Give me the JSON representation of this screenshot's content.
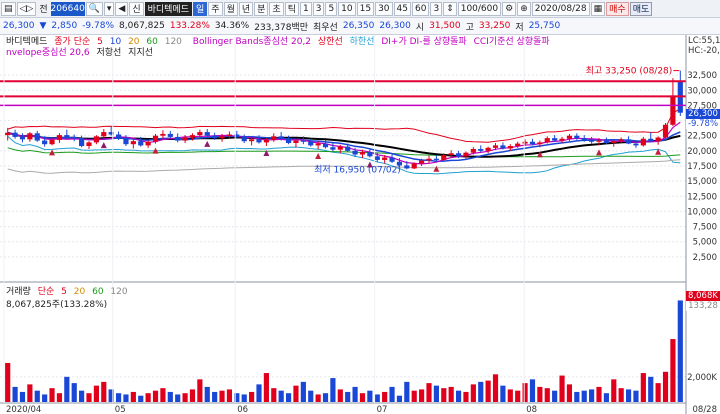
{
  "toolbar": {
    "code": "206640",
    "name": "바디텍메드",
    "period_selected": "일",
    "periods": [
      "주",
      "월",
      "년",
      "분",
      "초",
      "틱"
    ],
    "intervals": [
      "1",
      "3",
      "5",
      "10",
      "15",
      "30",
      "45",
      "60",
      "3"
    ],
    "range": "100/600",
    "date": "2020/08/28",
    "buy_label": "매수",
    "sell_label": "매도",
    "jeon": "전"
  },
  "quote": {
    "price": "26,300",
    "change": "2,850",
    "change_pct": "-9.78%",
    "volume": "8,067,825",
    "vol_ratio": "133.28%",
    "turnover": "34.36%",
    "amount": "233,378백만",
    "priority_label": "최우선",
    "bid": "26,350",
    "ask": "26,300",
    "open_label": "시",
    "open": "31,500",
    "high_label": "고",
    "high": "33,250",
    "low_label": "저",
    "low": "25,750"
  },
  "legend": {
    "name": "바디텍메드",
    "ma_label": "종가 단순",
    "ma5": "5",
    "ma10": "10",
    "ma20": "20",
    "ma60": "60",
    "ma120": "120",
    "bollinger": "Bollinger Bands종심선 20,2",
    "bb_upper": "상한선",
    "bb_lower": "하한선",
    "dmi": "DI+가 DI-를 상향돌파",
    "cci": "CCI기준선 상향돌파",
    "envelope": "nvelope중심선 20,6",
    "resistance": "저항선",
    "support": "지지선",
    "right_tag": "LC:55,1",
    "right_tag2": "HC:-20,"
  },
  "annotations": {
    "high": "최고 33,250 (08/28)",
    "low": "최저 16,950 (07/02)"
  },
  "price_axis": [
    "32,500",
    "30,000",
    "27,500",
    "25,000",
    "22,500",
    "20,000",
    "17,500",
    "15,000",
    "12,500",
    "10,000",
    "7,500",
    "5,000",
    "2,500"
  ],
  "price_tags": {
    "last": "26,300",
    "pct": "-9.78%"
  },
  "volume_legend": {
    "name": "거래량",
    "ma_label": "단순",
    "ma5": "5",
    "ma20": "20",
    "ma60": "60",
    "ma120": "120",
    "value": "8,067,825주(133.28%)"
  },
  "volume_axis": [
    "2,000K"
  ],
  "volume_tags": {
    "last": "8,068K",
    "pct": "133,28"
  },
  "x_axis": [
    "2020/04",
    "05",
    "06",
    "07",
    "08",
    "08/28"
  ],
  "colors": {
    "up": "#e0001c",
    "down": "#1947d6",
    "hline_red": "#e00034",
    "hline_magenta": "#c000c0"
  },
  "chart_data": {
    "type": "candlestick",
    "ylim": [
      0,
      35000
    ],
    "candles": [
      [
        22600,
        23800,
        21700,
        23000
      ],
      [
        23000,
        23500,
        22000,
        22300
      ],
      [
        22300,
        22900,
        21400,
        21900
      ],
      [
        21900,
        23100,
        21500,
        22900
      ],
      [
        22900,
        23300,
        21500,
        21700
      ],
      [
        21700,
        22400,
        20700,
        21100
      ],
      [
        21100,
        22100,
        20900,
        21800
      ],
      [
        21800,
        22900,
        21300,
        22600
      ],
      [
        22600,
        23500,
        22100,
        22300
      ],
      [
        22300,
        22700,
        21600,
        22100
      ],
      [
        22100,
        22500,
        20600,
        20800
      ],
      [
        20800,
        21600,
        20300,
        21400
      ],
      [
        21400,
        22600,
        21100,
        22400
      ],
      [
        22400,
        23600,
        22100,
        23100
      ],
      [
        23100,
        24000,
        22500,
        22700
      ],
      [
        22700,
        23200,
        21800,
        22000
      ],
      [
        22000,
        22600,
        20800,
        21100
      ],
      [
        21100,
        21900,
        20400,
        21600
      ],
      [
        21600,
        22300,
        20700,
        20900
      ],
      [
        20900,
        21700,
        20500,
        21500
      ],
      [
        21500,
        22800,
        21200,
        22500
      ],
      [
        22500,
        23400,
        22000,
        22800
      ],
      [
        22800,
        23300,
        22100,
        22300
      ],
      [
        22300,
        22900,
        21400,
        21700
      ],
      [
        21700,
        22600,
        21300,
        22200
      ],
      [
        22200,
        22900,
        21700,
        22600
      ],
      [
        22600,
        23500,
        22300,
        23100
      ],
      [
        23100,
        23600,
        22300,
        22500
      ],
      [
        22500,
        23000,
        21800,
        22100
      ],
      [
        22100,
        22800,
        21500,
        22400
      ],
      [
        22400,
        23200,
        22000,
        22700
      ],
      [
        22700,
        23300,
        22100,
        22300
      ],
      [
        22300,
        22700,
        21300,
        21600
      ],
      [
        21600,
        22300,
        20900,
        21900
      ],
      [
        21900,
        22600,
        21200,
        21400
      ],
      [
        21400,
        22100,
        20800,
        21800
      ],
      [
        21800,
        22900,
        21500,
        22400
      ],
      [
        22400,
        23100,
        21700,
        22000
      ],
      [
        22000,
        22500,
        21100,
        21300
      ],
      [
        21300,
        21900,
        20600,
        21700
      ],
      [
        21700,
        22400,
        21100,
        21500
      ],
      [
        21500,
        22000,
        20700,
        20900
      ],
      [
        20900,
        21600,
        20300,
        21200
      ],
      [
        21200,
        21800,
        20400,
        20600
      ],
      [
        20600,
        21300,
        19900,
        20200
      ],
      [
        20200,
        21000,
        19600,
        20700
      ],
      [
        20700,
        21200,
        19800,
        20000
      ],
      [
        20000,
        20500,
        19000,
        19400
      ],
      [
        19400,
        20200,
        18800,
        19800
      ],
      [
        19800,
        20400,
        18900,
        19100
      ],
      [
        19100,
        19700,
        18200,
        18500
      ],
      [
        18500,
        19300,
        17900,
        18900
      ],
      [
        18900,
        19400,
        18000,
        18200
      ],
      [
        18200,
        18800,
        17300,
        17600
      ],
      [
        17600,
        18300,
        16950,
        17100
      ],
      [
        17100,
        18100,
        17000,
        17900
      ],
      [
        17900,
        18700,
        17500,
        18400
      ],
      [
        18400,
        19200,
        18000,
        18700
      ],
      [
        18700,
        19300,
        18200,
        18500
      ],
      [
        18500,
        19600,
        18300,
        19300
      ],
      [
        19300,
        20100,
        18900,
        19600
      ],
      [
        19600,
        20000,
        18800,
        19100
      ],
      [
        19100,
        19900,
        18700,
        19700
      ],
      [
        19700,
        20600,
        19400,
        20300
      ],
      [
        20300,
        20900,
        19800,
        20000
      ],
      [
        20000,
        20700,
        19600,
        20500
      ],
      [
        20500,
        21300,
        20100,
        20900
      ],
      [
        20900,
        21400,
        20200,
        20400
      ],
      [
        20400,
        21100,
        20000,
        20800
      ],
      [
        20800,
        21500,
        20500,
        21200
      ],
      [
        21200,
        21900,
        20800,
        21500
      ],
      [
        21500,
        22000,
        20900,
        21100
      ],
      [
        21100,
        21700,
        20600,
        21400
      ],
      [
        21400,
        22400,
        21200,
        22100
      ],
      [
        22100,
        22600,
        21500,
        21700
      ],
      [
        21700,
        22300,
        21300,
        22000
      ],
      [
        22000,
        22800,
        21600,
        22500
      ],
      [
        22500,
        22900,
        21800,
        22100
      ],
      [
        22100,
        22600,
        21500,
        21800
      ],
      [
        21800,
        22300,
        21200,
        21500
      ],
      [
        21500,
        22100,
        20900,
        21700
      ],
      [
        21700,
        22200,
        21100,
        21300
      ],
      [
        21300,
        21800,
        20700,
        21600
      ],
      [
        21600,
        22200,
        21300,
        21900
      ],
      [
        21900,
        22400,
        21100,
        21200
      ],
      [
        21200,
        21700,
        20500,
        20900
      ],
      [
        20900,
        22300,
        20700,
        22000
      ],
      [
        22000,
        23100,
        21400,
        21600
      ],
      [
        21600,
        22400,
        21000,
        22200
      ],
      [
        22200,
        24600,
        22000,
        24300
      ],
      [
        24300,
        32000,
        24100,
        29150
      ],
      [
        31500,
        33250,
        25750,
        26300
      ]
    ],
    "volume": [
      3100,
      1200,
      800,
      1400,
      900,
      600,
      1100,
      700,
      2000,
      1500,
      900,
      700,
      1300,
      1600,
      1000,
      700,
      600,
      800,
      500,
      700,
      900,
      1100,
      800,
      600,
      700,
      1000,
      1800,
      1200,
      800,
      900,
      1000,
      700,
      600,
      800,
      1400,
      2300,
      1100,
      900,
      700,
      1300,
      1600,
      900,
      600,
      700,
      1900,
      1000,
      800,
      1200,
      700,
      900,
      600,
      800,
      1200,
      500,
      1600,
      900,
      1000,
      1500,
      1300,
      1100,
      1200,
      900,
      800,
      1400,
      1600,
      1700,
      2200,
      1300,
      1000,
      900,
      1500,
      1800,
      1200,
      1100,
      900,
      2100,
      1400,
      800,
      900,
      1000,
      1200,
      700,
      1800,
      1100,
      1000,
      900,
      2300,
      2000,
      1500,
      2400,
      5000,
      8068
    ],
    "volume_ylim": [
      0,
      8500
    ]
  }
}
